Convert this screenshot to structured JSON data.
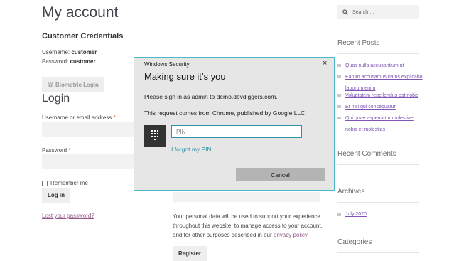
{
  "page": {
    "title": "My account",
    "credentials_heading": "Customer Credentials",
    "username_label": "Username:",
    "username_value": "customer",
    "password_label": "Password:",
    "password_value": "customer",
    "biometric_button": "Biometric Login",
    "login_heading": "Login",
    "username_email_label": "Username or email address",
    "required_mark": "*",
    "password_field_label": "Password",
    "remember_me": "Remember me",
    "login_button": "Log in",
    "lost_password": "Lost your password?",
    "privacy_text_1": "Your personal data will be used to support your experience",
    "privacy_text_2": "throughout this website, to manage access to your account,",
    "privacy_text_3": "and for other purposes described in our ",
    "privacy_link": "privacy policy",
    "privacy_end": ".",
    "register_button": "Register"
  },
  "sidebar": {
    "search_placeholder": "Search …",
    "recent_posts_heading": "Recent Posts",
    "posts": [
      "Quas nulla accusantium ut",
      "Earum accusamus natus explicabo",
      "laborum enim",
      "Voluptatem repellendus est nobis",
      "Et nisi qui consequatur",
      "Qui quae aspernatur molestiae",
      "nobis et molestias"
    ],
    "recent_comments_heading": "Recent Comments",
    "archives_heading": "Archives",
    "archive_item": "July 2020",
    "categories_heading": "Categories"
  },
  "dialog": {
    "window_title": "Windows Security",
    "close_glyph": "×",
    "heading": "Making sure it’s you",
    "line1": "Please sign in as admin to demo.devdiggers.com.",
    "line2": "This request comes from Chrome, published by Google LLC.",
    "pin_placeholder": "PIN",
    "forgot_pin": "I forgot my PIN",
    "cancel_button": "Cancel"
  },
  "icons": {
    "search": "search-icon",
    "keypad": "keypad-icon",
    "fingerprint": "fingerprint-icon",
    "close": "close-icon"
  },
  "colors": {
    "accent_purple": "#96588a",
    "dialog_border": "#4cb9c9",
    "dialog_link": "#2a8fa6",
    "required_red": "#e2401c"
  }
}
